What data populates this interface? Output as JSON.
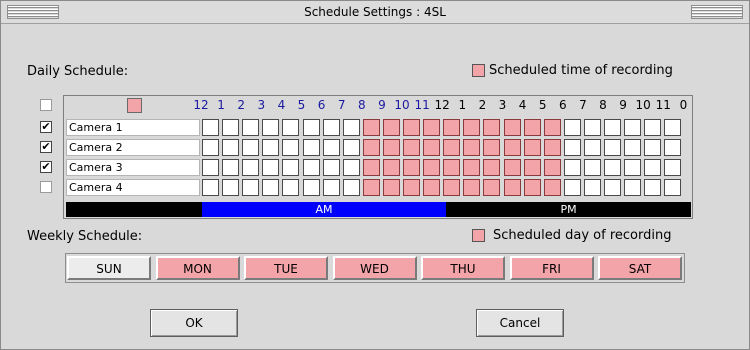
{
  "window": {
    "title": "Schedule Settings : 4SL"
  },
  "daily": {
    "label": "Daily Schedule:",
    "legend": "Scheduled time of recording",
    "select_all_checked": false,
    "hour_labels": [
      "12",
      "1",
      "2",
      "3",
      "4",
      "5",
      "6",
      "7",
      "8",
      "9",
      "10",
      "11",
      "12",
      "1",
      "2",
      "3",
      "4",
      "5",
      "6",
      "7",
      "8",
      "9",
      "10",
      "11",
      "0"
    ],
    "am_label": "AM",
    "pm_label": "PM",
    "cameras": [
      {
        "name": "Camera 1",
        "checked": true,
        "hours": [
          0,
          0,
          0,
          0,
          0,
          0,
          0,
          0,
          1,
          1,
          1,
          1,
          1,
          1,
          1,
          1,
          1,
          1,
          0,
          0,
          0,
          0,
          0,
          0
        ]
      },
      {
        "name": "Camera 2",
        "checked": true,
        "hours": [
          0,
          0,
          0,
          0,
          0,
          0,
          0,
          0,
          1,
          1,
          1,
          1,
          1,
          1,
          1,
          1,
          1,
          1,
          0,
          0,
          0,
          0,
          0,
          0
        ]
      },
      {
        "name": "Camera 3",
        "checked": true,
        "hours": [
          0,
          0,
          0,
          0,
          0,
          0,
          0,
          0,
          1,
          1,
          1,
          1,
          1,
          1,
          1,
          1,
          1,
          1,
          0,
          0,
          0,
          0,
          0,
          0
        ]
      },
      {
        "name": "Camera 4",
        "checked": false,
        "hours": [
          0,
          0,
          0,
          0,
          0,
          0,
          0,
          0,
          1,
          1,
          1,
          1,
          1,
          1,
          1,
          1,
          1,
          1,
          0,
          0,
          0,
          0,
          0,
          0
        ]
      }
    ]
  },
  "weekly": {
    "label": "Weekly Schedule:",
    "legend": "Scheduled day of recording",
    "days": [
      {
        "label": "SUN",
        "on": false
      },
      {
        "label": "MON",
        "on": true
      },
      {
        "label": "TUE",
        "on": true
      },
      {
        "label": "WED",
        "on": true
      },
      {
        "label": "THU",
        "on": true
      },
      {
        "label": "FRI",
        "on": true
      },
      {
        "label": "SAT",
        "on": true
      }
    ]
  },
  "buttons": {
    "ok": "OK",
    "cancel": "Cancel"
  },
  "colors": {
    "scheduled": "#f3a4a8",
    "am": "#0000ff",
    "hour_label": "#1a1aa0"
  }
}
